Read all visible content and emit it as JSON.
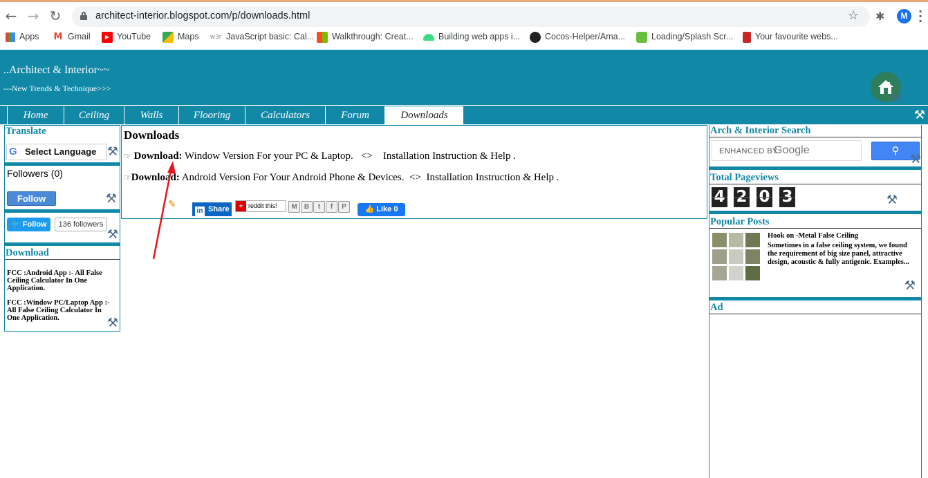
{
  "browser": {
    "url": "architect-interior.blogspot.com/p/downloads.html",
    "profile_initial": "M",
    "bookmarks": [
      {
        "label": "Apps",
        "icon": "apps-grid-icon"
      },
      {
        "label": "Gmail",
        "icon": "gmail-icon"
      },
      {
        "label": "YouTube",
        "icon": "youtube-icon"
      },
      {
        "label": "Maps",
        "icon": "maps-icon"
      },
      {
        "label": "JavaScript basic: Cal...",
        "icon": "w3r-icon"
      },
      {
        "label": "Walkthrough: Creat...",
        "icon": "microsoft-icon"
      },
      {
        "label": "Building web apps i...",
        "icon": "android-icon"
      },
      {
        "label": "Cocos-Helper/Ama...",
        "icon": "github-icon"
      },
      {
        "label": "Loading/Splash Scr...",
        "icon": "android-studio-icon"
      },
      {
        "label": "Your favourite webs...",
        "icon": "phone-app-icon"
      }
    ],
    "w3r_badge": "w3r"
  },
  "site": {
    "title": "..Architect & Interior~~",
    "description": "---New Trends & Technique>>>"
  },
  "nav": {
    "tabs": [
      "Home",
      "Ceiling",
      "Walls",
      "Flooring",
      "Calculators",
      "Forum",
      "Downloads"
    ],
    "active": "Downloads"
  },
  "left": {
    "translate_title": "Translate",
    "select_language": "Select Language",
    "followers": "Followers (0)",
    "follow_label": "Follow",
    "twitter_follow": "Follow",
    "twitter_count": "136 followers",
    "download_title": "Download",
    "links": [
      "FCC :Android App :- All False Ceiling Calculator In One Application.",
      "FCC :Window PC/Laptop App :- All False Ceiling Calculator In One Application."
    ]
  },
  "main": {
    "title": "Downloads",
    "line1": {
      "label": "Download:",
      "text": "Window Version For your PC & Laptop.",
      "sep": "<>",
      "link": "Installation Instruction & Help ."
    },
    "line2": {
      "label": "Download:",
      "text": "Android Version For Your Android Phone & Devices.",
      "sep": "<>",
      "link": "Installation Instruction & Help ."
    },
    "share_label": "Share",
    "reddit_label": "reddit this!",
    "like_label": "Like 0"
  },
  "right": {
    "search_title": "Arch & Interior Search",
    "search_enhanced": "ENHANCED BY",
    "search_google": "Google",
    "pageviews_title": "Total Pageviews",
    "pageviews_digits": [
      "4",
      "2",
      "0",
      "3"
    ],
    "popular_title": "Popular Posts",
    "post_title": "Hook on -Metal False Ceiling",
    "post_snippet": "Sometimes in a false ceiling system, we found the requirement of big size panel, attractive design, acoustic & fully antigenic. Examples...",
    "ad_title": "Ad"
  },
  "colors": {
    "brand_teal": "#1288a7",
    "annotation_red": "#e8141c"
  }
}
